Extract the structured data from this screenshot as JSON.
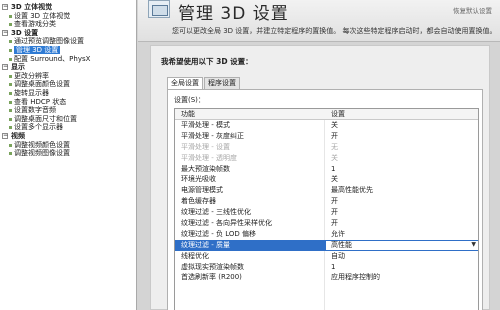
{
  "window": {
    "title": "管理 3D 设置",
    "restore_label": "恢复默认设置",
    "description": "您可以更改全局 3D 设置，并建立特定程序的置换值。 每次这些特定程序启动时，都会自动使用置换值。"
  },
  "tree": [
    {
      "label": "3D 立体视觉",
      "group": true
    },
    {
      "label": "设置 3D 立体视觉"
    },
    {
      "label": "查看游戏分类"
    },
    {
      "label": "3D 设置",
      "group": true
    },
    {
      "label": "通过预览调整图像设置"
    },
    {
      "label": "管理 3D 设置",
      "selected": true
    },
    {
      "label": "配置 Surround、PhysX"
    },
    {
      "label": "显示",
      "group": true
    },
    {
      "label": "更改分辨率"
    },
    {
      "label": "调整桌面颜色设置"
    },
    {
      "label": "旋转显示器"
    },
    {
      "label": "查看 HDCP 状态"
    },
    {
      "label": "设置数字音频"
    },
    {
      "label": "调整桌面尺寸和位置"
    },
    {
      "label": "设置多个显示器"
    },
    {
      "label": "视频",
      "group": true
    },
    {
      "label": "调整视频颜色设置"
    },
    {
      "label": "调整视频图像设置"
    }
  ],
  "panel": {
    "heading": "我希望使用以下 3D 设置：",
    "tabs": [
      "全局设置",
      "程序设置"
    ],
    "settings_label": "设置(S)：",
    "columns": [
      "功能",
      "设置"
    ],
    "rows": [
      {
        "feature": "平滑处理 - 模式",
        "value": "关"
      },
      {
        "feature": "平滑处理 - 灰度纠正",
        "value": "开"
      },
      {
        "feature": "平滑处理 - 设置",
        "value": "无",
        "disabled": true
      },
      {
        "feature": "平滑处理 - 透明度",
        "value": "关",
        "disabled": true
      },
      {
        "feature": "最大预渲染帧数",
        "value": "1"
      },
      {
        "feature": "环境光吸收",
        "value": "关"
      },
      {
        "feature": "电源管理模式",
        "value": "最高性能优先"
      },
      {
        "feature": "着色缓存器",
        "value": "开"
      },
      {
        "feature": "纹理过滤 - 三线性优化",
        "value": "开"
      },
      {
        "feature": "纹理过滤 - 各向异性采样优化",
        "value": "开"
      },
      {
        "feature": "纹理过滤 - 负 LOD 偏移",
        "value": "允许"
      },
      {
        "feature": "纹理过滤 - 质量",
        "value": "高性能",
        "selected": true
      },
      {
        "feature": "线程优化",
        "value": "自动"
      },
      {
        "feature": "虚拟现实预渲染帧数",
        "value": "1"
      },
      {
        "feature": "首选刷新率 (R200)",
        "value": "应用程序控制的"
      }
    ]
  }
}
